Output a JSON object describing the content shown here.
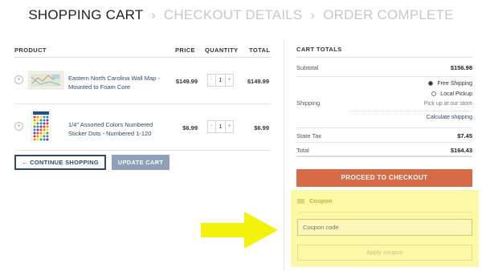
{
  "steps": {
    "cart": "SHOPPING CART",
    "separator": "›",
    "details": "CHECKOUT DETAILS",
    "complete": "ORDER COMPLETE"
  },
  "cart": {
    "headers": {
      "product": "PRODUCT",
      "price": "PRICE",
      "quantity": "QUANTITY",
      "total": "TOTAL"
    },
    "remove_glyph": "×",
    "items": [
      {
        "name": "Eastern North Carolina Wall Map - Mounted to Foam Core",
        "price": "$149.99",
        "quantity": "1",
        "subtotal": "$149.99"
      },
      {
        "name": "1/4\" Assorted Colors Numbered Sticker Dots - Numbered 1-120",
        "price": "$6.99",
        "quantity": "1",
        "subtotal": "$6.99"
      }
    ],
    "qty_minus": "-",
    "qty_plus": "+",
    "continue_label": "← CONTINUE SHOPPING",
    "update_label": "UPDATE CART"
  },
  "totals": {
    "title": "CART TOTALS",
    "subtotal_label": "Subtotal",
    "subtotal": "$156.98",
    "shipping_label": "Shipping",
    "shipping_options": [
      "Free Shipping",
      "Local Pickup"
    ],
    "pickup_note": "Pick up at our store",
    "calc_link": "Calculate shipping",
    "tax_label": "State Tax",
    "tax": "$7.45",
    "total_label": "Total",
    "total": "$164.43",
    "checkout_label": "PROCEED TO CHECKOUT"
  },
  "coupon": {
    "heading": "Coupon",
    "placeholder": "Coupon code",
    "apply_label": "Apply coupon"
  },
  "colors": {
    "accent_blue": "#2b4a73",
    "checkout_orange": "#d66b45",
    "highlight_yellow": "#fbf9a6",
    "arrow_yellow": "#f3f20a"
  },
  "icons": [
    "remove-icon",
    "map-thumbnail",
    "sticker-dots-thumbnail",
    "coupon-tag-icon",
    "pointer-arrow"
  ]
}
